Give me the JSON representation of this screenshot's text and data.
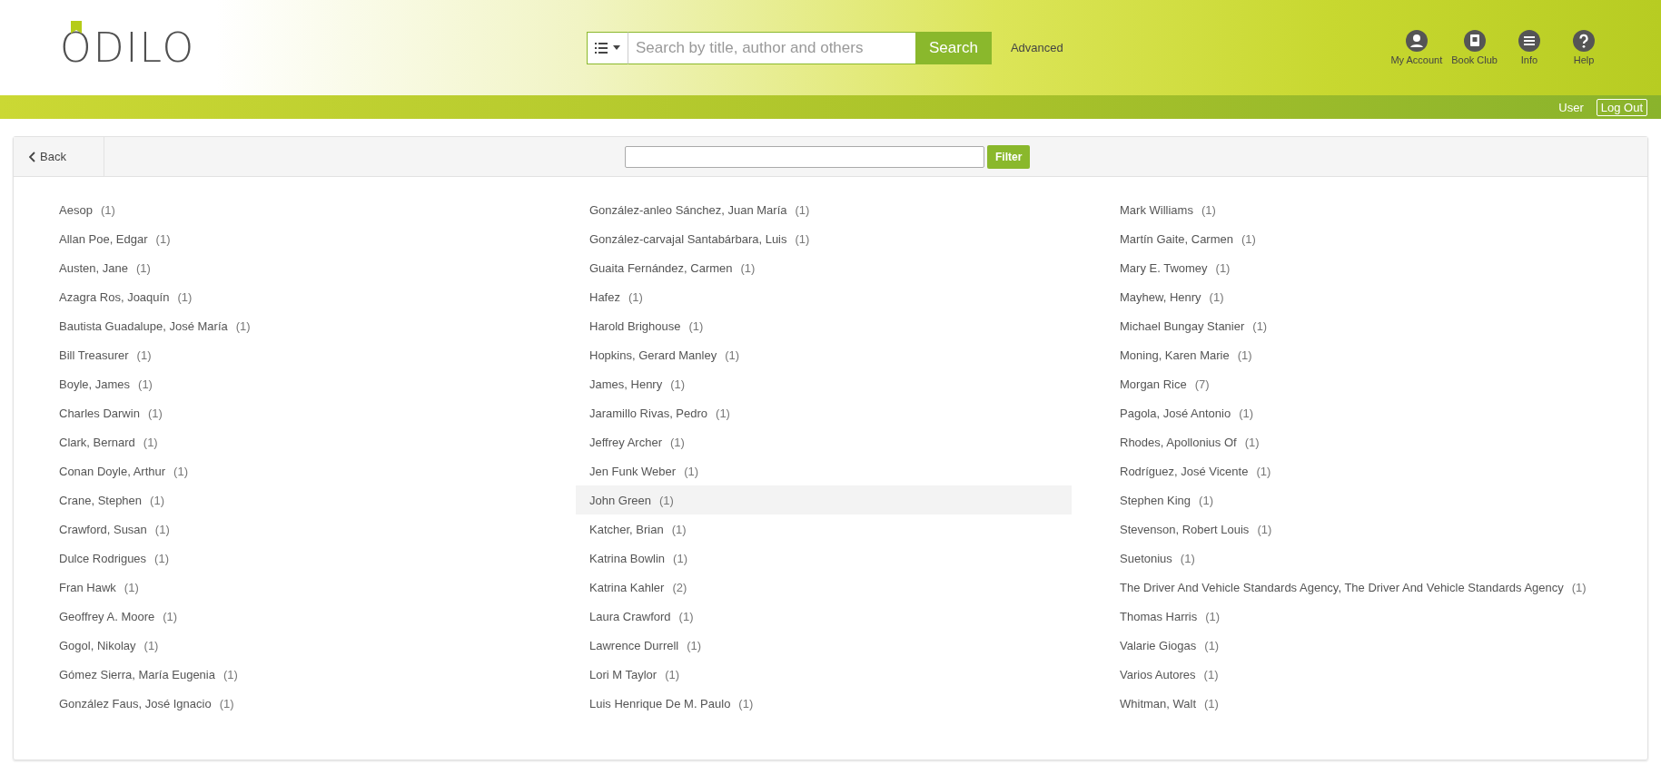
{
  "header": {
    "logo": "ODILO",
    "search": {
      "placeholder": "Search by title, author and others",
      "button": "Search"
    },
    "advanced_link": "Advanced",
    "nav": [
      {
        "label": "My Account",
        "kind": "account"
      },
      {
        "label": "Book Club",
        "kind": "club"
      },
      {
        "label": "Info",
        "kind": "info"
      },
      {
        "label": "Help",
        "kind": "help"
      }
    ]
  },
  "user_bar": {
    "user": "User",
    "logout": "Log Out"
  },
  "toolbar": {
    "back": "Back",
    "filter_button": "Filter"
  },
  "columns": [
    [
      {
        "name": "Aesop",
        "count": "(1)",
        "highlighted": false
      },
      {
        "name": "Allan Poe, Edgar",
        "count": "(1)",
        "highlighted": false
      },
      {
        "name": "Austen, Jane",
        "count": "(1)",
        "highlighted": false
      },
      {
        "name": "Azagra Ros, Joaquín",
        "count": "(1)",
        "highlighted": false
      },
      {
        "name": "Bautista Guadalupe, José María",
        "count": "(1)",
        "highlighted": false
      },
      {
        "name": "Bill Treasurer",
        "count": "(1)",
        "highlighted": false
      },
      {
        "name": "Boyle, James",
        "count": "(1)",
        "highlighted": false
      },
      {
        "name": "Charles Darwin",
        "count": "(1)",
        "highlighted": false
      },
      {
        "name": "Clark, Bernard",
        "count": "(1)",
        "highlighted": false
      },
      {
        "name": "Conan Doyle, Arthur",
        "count": "(1)",
        "highlighted": false
      },
      {
        "name": "Crane, Stephen",
        "count": "(1)",
        "highlighted": false
      },
      {
        "name": "Crawford, Susan",
        "count": "(1)",
        "highlighted": false
      },
      {
        "name": "Dulce Rodrigues",
        "count": "(1)",
        "highlighted": false
      },
      {
        "name": "Fran Hawk",
        "count": "(1)",
        "highlighted": false
      },
      {
        "name": "Geoffrey A. Moore",
        "count": "(1)",
        "highlighted": false
      },
      {
        "name": "Gogol, Nikolay",
        "count": "(1)",
        "highlighted": false
      },
      {
        "name": "Gómez Sierra, María Eugenia",
        "count": "(1)",
        "highlighted": false
      },
      {
        "name": "González Faus, José Ignacio",
        "count": "(1)",
        "highlighted": false
      }
    ],
    [
      {
        "name": "González-anleo Sánchez, Juan María",
        "count": "(1)",
        "highlighted": false
      },
      {
        "name": "González-carvajal Santabárbara, Luis",
        "count": "(1)",
        "highlighted": false
      },
      {
        "name": "Guaita Fernández, Carmen",
        "count": "(1)",
        "highlighted": false
      },
      {
        "name": "Hafez",
        "count": "(1)",
        "highlighted": false
      },
      {
        "name": "Harold Brighouse",
        "count": "(1)",
        "highlighted": false
      },
      {
        "name": "Hopkins, Gerard Manley",
        "count": "(1)",
        "highlighted": false
      },
      {
        "name": "James, Henry",
        "count": "(1)",
        "highlighted": false
      },
      {
        "name": "Jaramillo Rivas, Pedro",
        "count": "(1)",
        "highlighted": false
      },
      {
        "name": "Jeffrey Archer",
        "count": "(1)",
        "highlighted": false
      },
      {
        "name": "Jen Funk Weber",
        "count": "(1)",
        "highlighted": false
      },
      {
        "name": "John Green",
        "count": "(1)",
        "highlighted": true
      },
      {
        "name": "Katcher, Brian",
        "count": "(1)",
        "highlighted": false
      },
      {
        "name": "Katrina Bowlin",
        "count": "(1)",
        "highlighted": false
      },
      {
        "name": "Katrina Kahler",
        "count": "(2)",
        "highlighted": false
      },
      {
        "name": "Laura Crawford",
        "count": "(1)",
        "highlighted": false
      },
      {
        "name": "Lawrence Durrell",
        "count": "(1)",
        "highlighted": false
      },
      {
        "name": "Lori M Taylor",
        "count": "(1)",
        "highlighted": false
      },
      {
        "name": "Luis Henrique De M. Paulo",
        "count": "(1)",
        "highlighted": false
      }
    ],
    [
      {
        "name": "Mark Williams",
        "count": "(1)",
        "highlighted": false
      },
      {
        "name": "Martín Gaite, Carmen",
        "count": "(1)",
        "highlighted": false
      },
      {
        "name": "Mary E. Twomey",
        "count": "(1)",
        "highlighted": false
      },
      {
        "name": "Mayhew, Henry",
        "count": "(1)",
        "highlighted": false
      },
      {
        "name": "Michael Bungay Stanier",
        "count": "(1)",
        "highlighted": false
      },
      {
        "name": "Moning, Karen Marie",
        "count": "(1)",
        "highlighted": false
      },
      {
        "name": "Morgan Rice",
        "count": "(7)",
        "highlighted": false
      },
      {
        "name": "Pagola, José Antonio",
        "count": "(1)",
        "highlighted": false
      },
      {
        "name": "Rhodes, Apollonius Of",
        "count": "(1)",
        "highlighted": false
      },
      {
        "name": "Rodríguez, José Vicente",
        "count": "(1)",
        "highlighted": false
      },
      {
        "name": "Stephen King",
        "count": "(1)",
        "highlighted": false
      },
      {
        "name": "Stevenson, Robert Louis",
        "count": "(1)",
        "highlighted": false
      },
      {
        "name": "Suetonius",
        "count": "(1)",
        "highlighted": false
      },
      {
        "name": "The Driver And Vehicle Standards Agency, The Driver And Vehicle Standards Agency",
        "count": "(1)",
        "highlighted": false
      },
      {
        "name": "Thomas Harris",
        "count": "(1)",
        "highlighted": false
      },
      {
        "name": "Valarie Giogas",
        "count": "(1)",
        "highlighted": false
      },
      {
        "name": "Varios Autores",
        "count": "(1)",
        "highlighted": false
      },
      {
        "name": "Whitman, Walt",
        "count": "(1)",
        "highlighted": false
      }
    ]
  ]
}
